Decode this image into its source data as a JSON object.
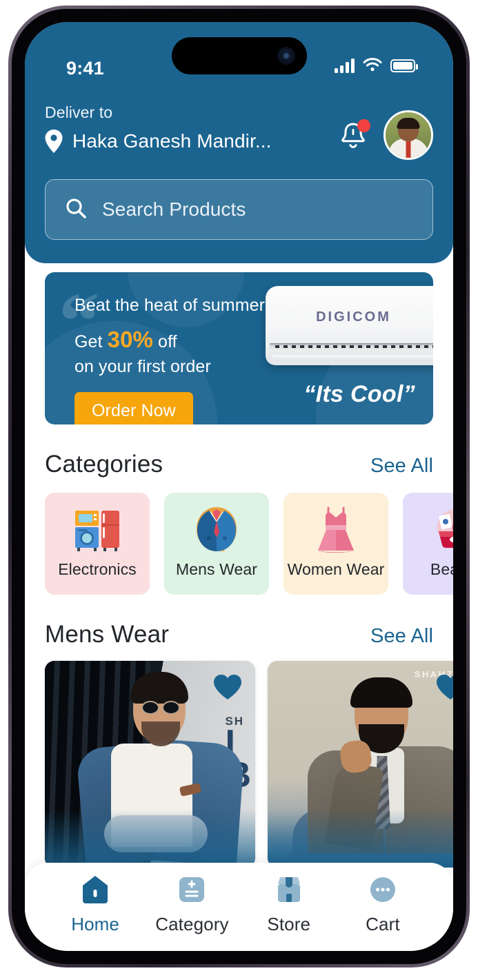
{
  "status_bar": {
    "time": "9:41",
    "signal_icon": "cellular-signal-icon",
    "wifi_icon": "wifi-icon",
    "battery_icon": "battery-icon"
  },
  "header": {
    "deliver_label": "Deliver to",
    "address": "Haka Ganesh Mandir...",
    "location_icon": "location-pin-icon",
    "bell_icon": "notification-bell-icon",
    "has_notification": true,
    "avatar_icon": "user-avatar",
    "background_color": "#1b6490"
  },
  "search": {
    "placeholder": "Search Products",
    "icon": "search-icon"
  },
  "banner": {
    "line1": "Beat the heat of summer",
    "line2_prefix": "Get ",
    "line2_highlight": "30%",
    "line2_suffix": " off",
    "line3": "on your first order",
    "cta_label": "Order Now",
    "tagline": "“Its Cool”",
    "product_brand": "DIGICOM",
    "quote_glyph": "“",
    "background_color": "#1b6490",
    "cta_color": "#f6a50b",
    "highlight_color": "#f9a825"
  },
  "categories_section": {
    "title": "Categories",
    "see_all_label": "See All",
    "items": [
      {
        "label": "Electronics",
        "icon": "appliances-icon",
        "bg": "#fbdfe0"
      },
      {
        "label": "Mens Wear",
        "icon": "suit-icon",
        "bg": "#ddf3e3"
      },
      {
        "label": "Women Wear",
        "icon": "dress-icon",
        "bg": "#fdefd8"
      },
      {
        "label": "Beauty",
        "icon": "cosmetics-icon",
        "bg": "#e3dcfb"
      }
    ]
  },
  "mens_wear_section": {
    "title": "Mens Wear",
    "see_all_label": "See All",
    "products": [
      {
        "alt": "man-in-blue-blazer",
        "favorite_icon": "heart-icon",
        "favorited": true
      },
      {
        "alt": "man-in-gray-suit",
        "favorite_icon": "heart-icon",
        "favorited": true,
        "watermark": "SHAHZEB"
      }
    ]
  },
  "bottom_nav": {
    "items": [
      {
        "label": "Home",
        "icon": "home-icon",
        "active": true
      },
      {
        "label": "Category",
        "icon": "category-icon",
        "active": false
      },
      {
        "label": "Store",
        "icon": "store-icon",
        "active": false
      },
      {
        "label": "Cart",
        "icon": "cart-more-icon",
        "active": false
      }
    ],
    "active_color": "#1b6490",
    "inactive_color": "#8fb4cb"
  }
}
